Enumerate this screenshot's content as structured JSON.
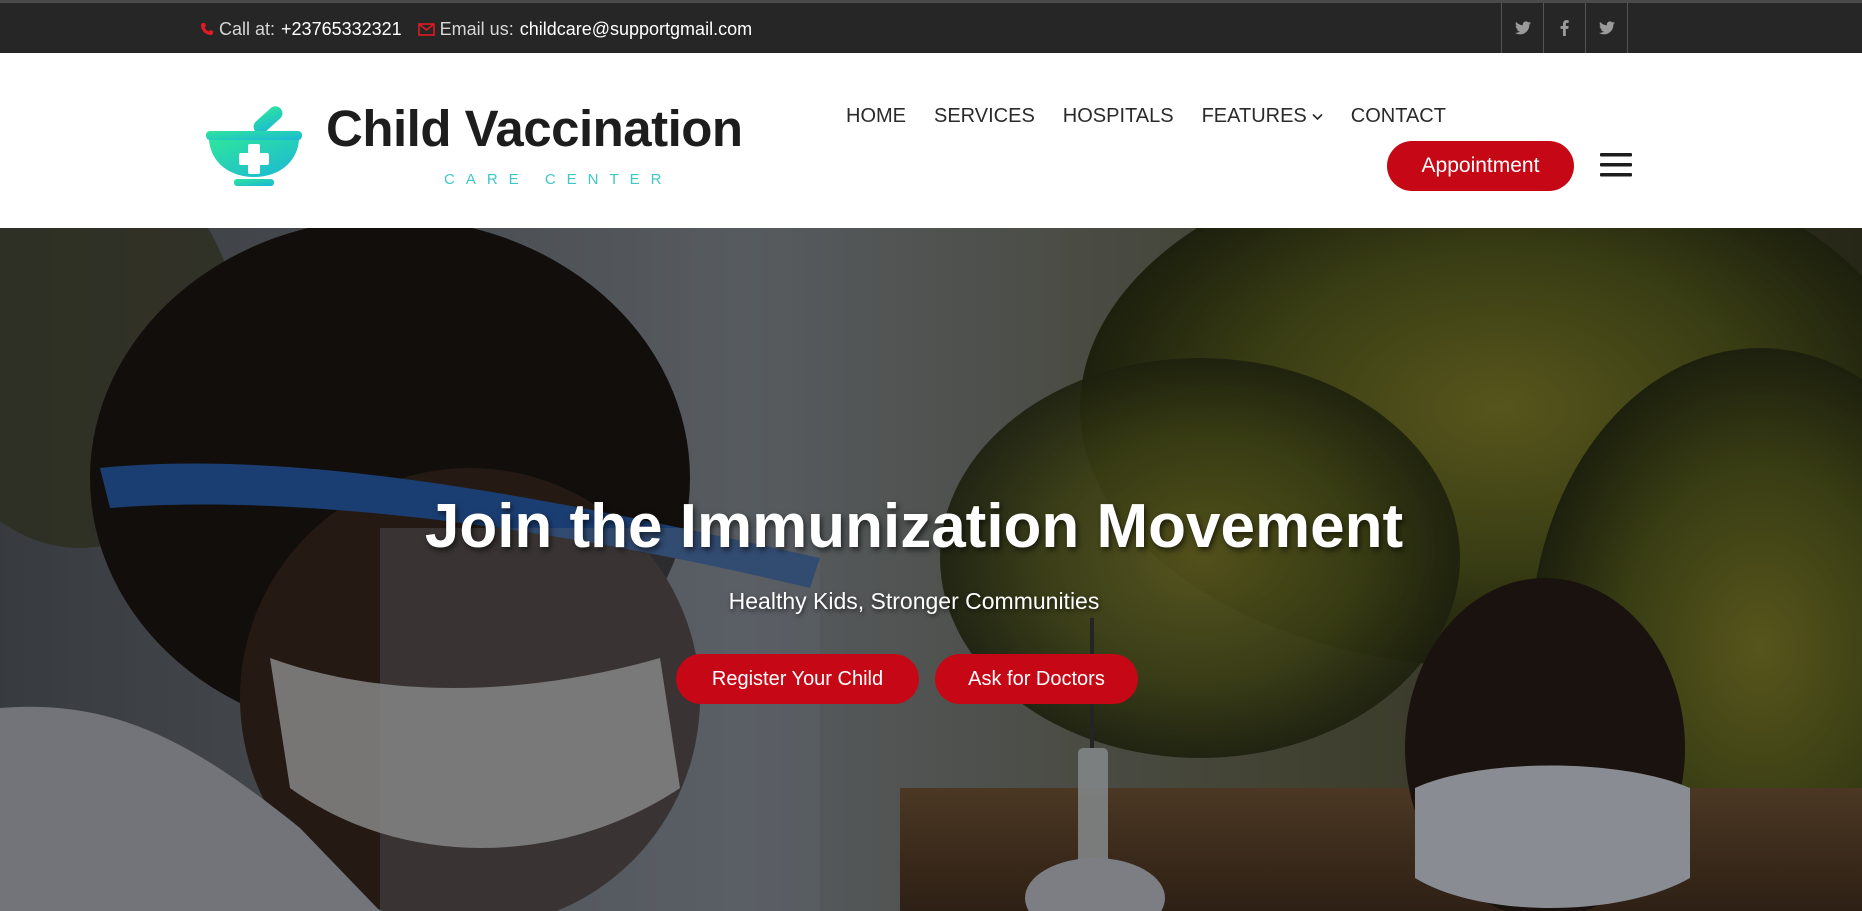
{
  "topbar": {
    "call_label": "Call at:",
    "phone": "+23765332321",
    "email_label": "Email us:",
    "email": "childcare@supportgmail.com",
    "icon_phone": "phone-icon",
    "icon_email": "envelope-icon",
    "social": [
      "twitter-icon",
      "facebook-icon",
      "twitter-icon"
    ]
  },
  "brand": {
    "title": "Child Vaccination",
    "subtitle": "CARE CENTER",
    "logo_icon": "mortar-pestle-cross-icon"
  },
  "nav": {
    "items": [
      "HOME",
      "SERVICES",
      "HOSPITALS",
      "FEATURES",
      "CONTACT"
    ],
    "appointment": "Appointment",
    "menu_icon": "hamburger-menu-icon"
  },
  "hero": {
    "title": "Join the Immunization Movement",
    "subtitle": "Healthy Kids, Stronger Communities",
    "buttons": [
      "Register Your Child",
      "Ask for Doctors"
    ]
  },
  "colors": {
    "topbar_bg": "#262626",
    "accent_red": "#c60715",
    "brand_teal": "#3ec7c7",
    "brand_green": "#2ee59d"
  }
}
